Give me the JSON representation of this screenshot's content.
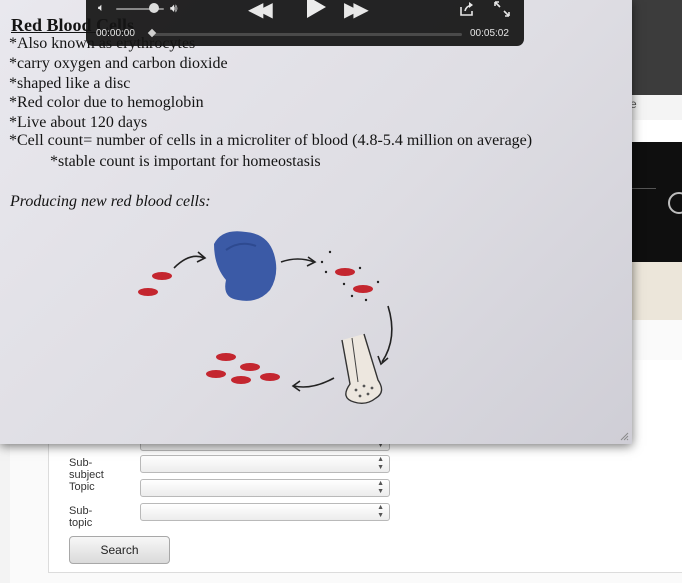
{
  "slide": {
    "title": "Red Blood Cells",
    "bullets": [
      "*Also known as erythrocytes",
      "*carry oxygen and carbon dioxide",
      "*shaped like a disc",
      "*Red color due to hemoglobin",
      "*Live about 120 days",
      "*Cell count= number of cells in a microliter of blood (4.8-5.4 million on average)",
      "*stable count is important for homeostasis"
    ],
    "subheading": "Producing new red blood cells:"
  },
  "player": {
    "time_current": "00:00:00",
    "time_total": "00:05:02",
    "volume_fraction": 0.8,
    "progress_fraction": 0.0,
    "icons": {
      "volume_low": "speaker-icon",
      "volume_high": "speaker-loud-icon",
      "rewind": "rewind-icon",
      "play": "play-icon",
      "fast_forward": "fast-forward-icon",
      "share": "share-icon",
      "fullscreen": "fullscreen-icon"
    }
  },
  "bg_page": {
    "strip_text": "e"
  },
  "form": {
    "rows": [
      {
        "label": "",
        "value": ""
      },
      {
        "label": "Sub-subject",
        "value": ""
      },
      {
        "label": "Topic",
        "value": ""
      },
      {
        "label": "Sub-topic",
        "value": ""
      }
    ],
    "search_label": "Search"
  },
  "colors": {
    "hud_background": "#141414",
    "rbc_red": "#c4262f",
    "stem_cell_blue": "#3b5aa6"
  }
}
